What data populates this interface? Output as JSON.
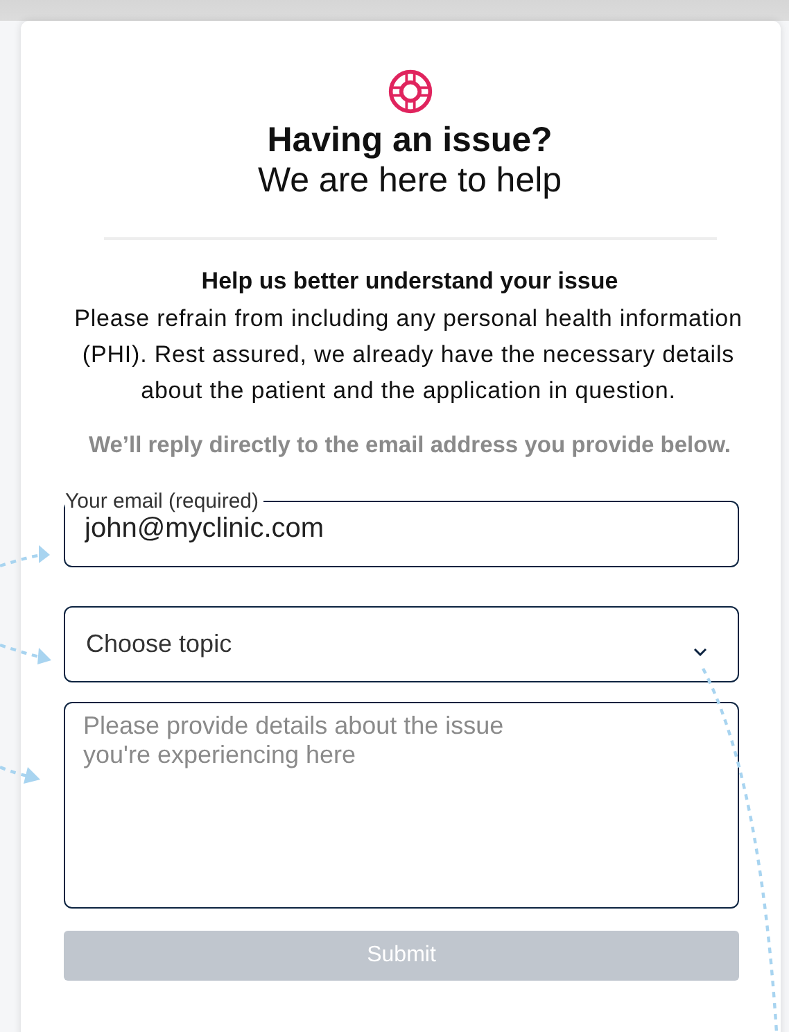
{
  "header": {
    "title": "Having an issue?",
    "subtitle": "We are here to help"
  },
  "intro": {
    "heading": "Help us better understand your issue",
    "text": "Please refrain from including any personal health information (PHI). Rest assured, we already have the necessary details about the patient and the application in question.",
    "note": "We’ll reply directly to the email address you provide below."
  },
  "form": {
    "email": {
      "label": "Your email (required)",
      "value": "john@myclinic.com"
    },
    "topic": {
      "placeholder": "Choose topic"
    },
    "details": {
      "placeholder": "Please provide details about the issue\nyou're experiencing here"
    },
    "submit": {
      "label": "Submit",
      "disabled": true
    }
  }
}
